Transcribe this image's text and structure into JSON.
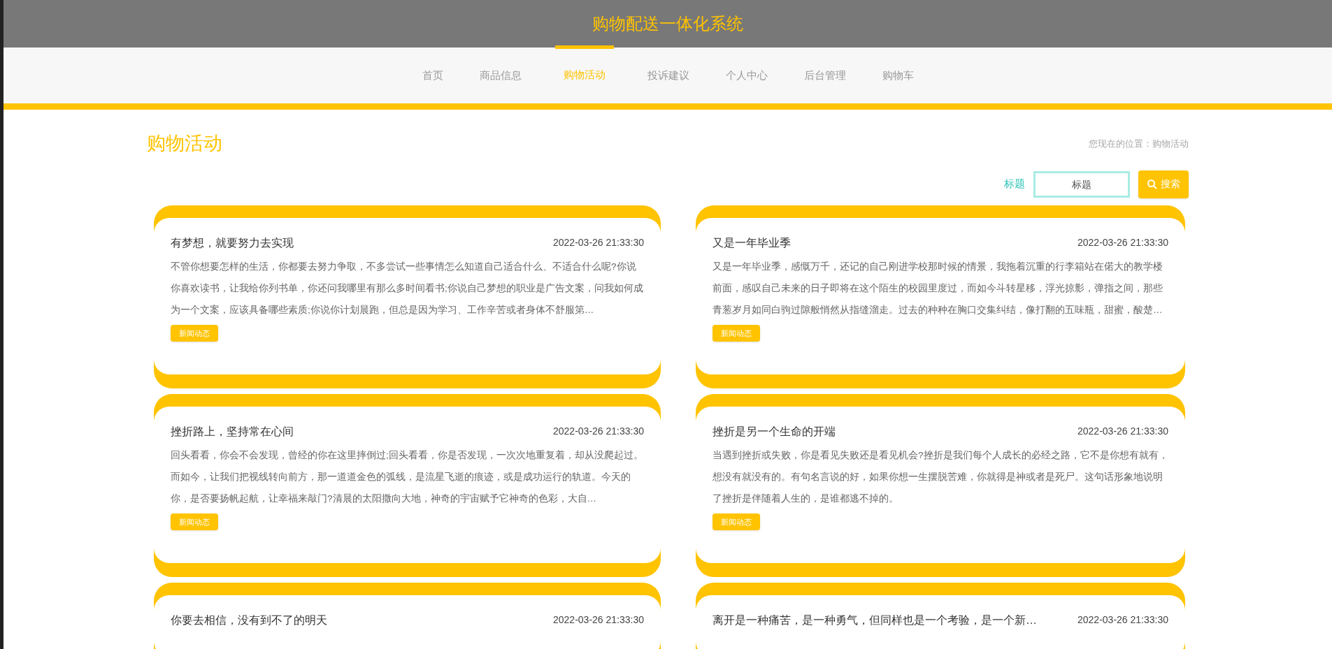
{
  "header": {
    "title": "购物配送一体化系统"
  },
  "nav": [
    {
      "label": "首页",
      "selected": false
    },
    {
      "label": "商品信息",
      "selected": false
    },
    {
      "label": "购物活动",
      "selected": true
    },
    {
      "label": "投诉建议",
      "selected": false
    },
    {
      "label": "个人中心",
      "selected": false
    },
    {
      "label": "后台管理",
      "selected": false
    },
    {
      "label": "购物车",
      "selected": false
    }
  ],
  "page_title": "购物活动",
  "breadcrumb": "您现在的位置：购物活动",
  "search": {
    "label": "标题",
    "placeholder": "标题",
    "button": "搜索"
  },
  "articles": [
    {
      "title": "有梦想，就要努力去实现",
      "date": "2022-03-26 21:33:30",
      "summary": "不管你想要怎样的生活，你都要去努力争取，不多尝试一些事情怎么知道自己适合什么、不适合什么呢?你说你喜欢读书，让我给你列书单，你还问我哪里有那么多时间看书;你说自己梦想的职业是广告文案，问我如何成为一个文案，应该具备哪些素质;你说你计划晨跑，但总是因为学习、工作辛苦或者身体不舒服第…",
      "tag": "新闻动态"
    },
    {
      "title": "又是一年毕业季",
      "date": "2022-03-26 21:33:30",
      "summary": "又是一年毕业季，感慨万千，还记的自己刚进学校那时候的情景，我拖着沉重的行李箱站在偌大的教学楼前面，感叹自己未来的日子即将在这个陌生的校园里度过，而如今斗转星移，浮光掠影，弹指之间，那些青葱岁月如同白驹过隙般悄然从指缝溜走。过去的种种在胸口交集纠结，像打翻的五味瓶，甜蜜，酸楚…",
      "tag": "新闻动态"
    },
    {
      "title": "挫折路上，坚持常在心间",
      "date": "2022-03-26 21:33:30",
      "summary": "回头看看，你会不会发现，曾经的你在这里摔倒过;回头看看，你是否发现，一次次地重复着，却从没爬起过。而如今，让我们把视线转向前方，那一道道金色的弧线，是流星飞逝的痕迹，或是成功运行的轨道。今天的你，是否要扬帆起航，让幸福来敲门?清晨的太阳撒向大地，神奇的宇宙赋予它神奇的色彩，大自…",
      "tag": "新闻动态"
    },
    {
      "title": "挫折是另一个生命的开端",
      "date": "2022-03-26 21:33:30",
      "summary": "当遇到挫折或失败，你是看见失败还是看见机会?挫折是我们每个人成长的必经之路，它不是你想有就有，想没有就没有的。有句名言说的好，如果你想一生摆脱苦难，你就得是神或者是死尸。这句话形象地说明了挫折是伴随着人生的，是谁都逃不掉的。",
      "tag": "新闻动态"
    },
    {
      "title": "你要去相信，没有到不了的明天",
      "date": "2022-03-26 21:33:30"
    },
    {
      "title": "离开是一种痛苦，是一种勇气，但同样也是一个考验，是一个新…",
      "date": "2022-03-26 21:33:30"
    }
  ]
}
